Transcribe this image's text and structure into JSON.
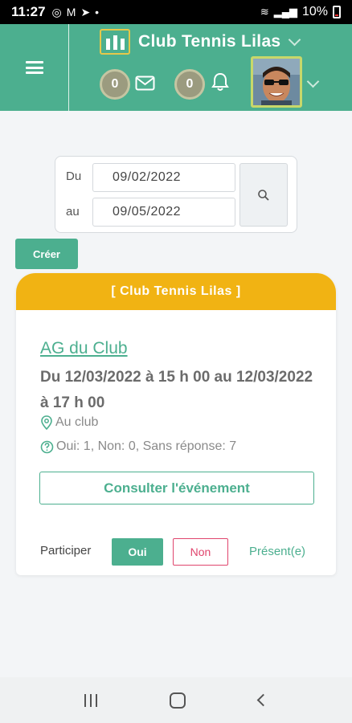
{
  "status_bar": {
    "time": "11:27",
    "battery": "10%"
  },
  "header": {
    "club_name": "Club Tennis Lilas",
    "messages_count": "0",
    "notifications_count": "0"
  },
  "filter": {
    "from_label": "Du",
    "from_value": "09/02/2022",
    "to_label": "au",
    "to_value": "09/05/2022"
  },
  "create_label": "Créer",
  "event": {
    "club_header": "[ Club Tennis Lilas ]",
    "title": "AG du Club",
    "date_text": "Du 12/03/2022 à 15 h 00 au 12/03/2022 à 17 h 00",
    "location": "Au club",
    "responses": "Oui: 1, Non: 0, Sans réponse: 7",
    "consult_label": "Consulter l'événement",
    "participate_label": "Participer",
    "yes_label": "Oui",
    "no_label": "Non",
    "status": "Présent(e)"
  },
  "colors": {
    "primary": "#4caf8f",
    "club_header": "#f1b313",
    "danger": "#e0456d"
  }
}
